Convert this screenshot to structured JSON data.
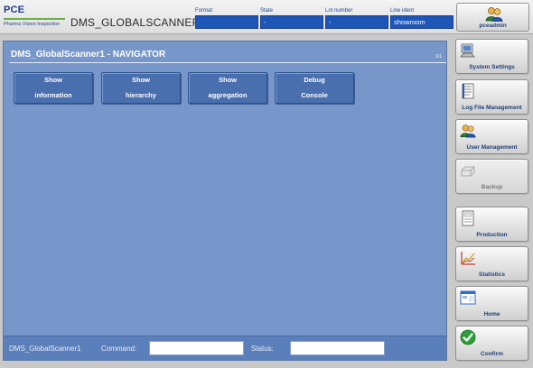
{
  "header": {
    "logo_main": "PCE",
    "logo_sub": "Pharma Vision Inspection",
    "app_title": "DMS_GLOBALSCANNER1",
    "fields": [
      {
        "label": "Format",
        "value": ""
      },
      {
        "label": "State",
        "value": "-"
      },
      {
        "label": "Lot number",
        "value": "-"
      },
      {
        "label": "Line ident",
        "value": "showroom"
      }
    ],
    "user": {
      "name": "pceadmin",
      "icon": "users-icon"
    }
  },
  "panel": {
    "title": "DMS_GlobalScanner1 - NAVIGATOR",
    "page_indicator": "1/1",
    "buttons": [
      {
        "line1": "Show",
        "line2": "information"
      },
      {
        "line1": "Show",
        "line2": "hierarchy"
      },
      {
        "line1": "Show",
        "line2": "aggregation"
      },
      {
        "line1": "Debug",
        "line2": "Console"
      }
    ],
    "status_bar": {
      "device": "DMS_GlobalScanner1",
      "command_label": "Command:",
      "command_value": "",
      "status_label": "Status:",
      "status_value": ""
    }
  },
  "sidebar": {
    "items": [
      {
        "label": "System Settings",
        "icon": "computer-icon",
        "enabled": true
      },
      {
        "label": "Log File Management",
        "icon": "log-file-icon",
        "enabled": true
      },
      {
        "label": "User Management",
        "icon": "users-icon",
        "enabled": true
      },
      {
        "label": "Backup",
        "icon": "backup-drive-icon",
        "enabled": false
      },
      {
        "label": "Production",
        "icon": "document-icon",
        "enabled": true
      },
      {
        "label": "Statistics",
        "icon": "chart-icon",
        "enabled": true
      },
      {
        "label": "Home",
        "icon": "window-icon",
        "enabled": true
      },
      {
        "label": "Confirm",
        "icon": "check-icon",
        "enabled": true
      }
    ]
  },
  "colors": {
    "panel_bg": "#7796c9",
    "button_bg": "#4a6fae",
    "field_bg": "#1d56b8",
    "label_blue": "#1f3f7a"
  }
}
